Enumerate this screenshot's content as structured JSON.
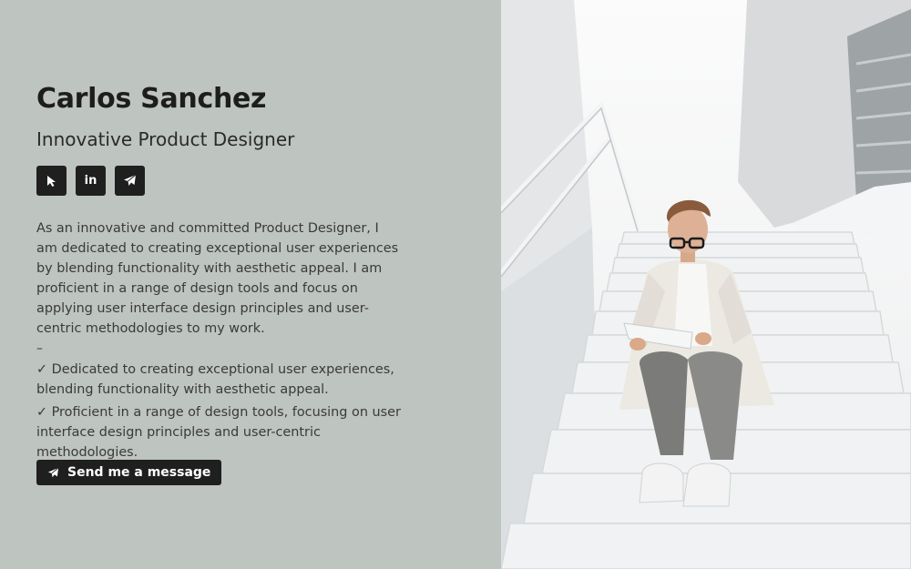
{
  "profile": {
    "name": "Carlos Sanchez",
    "role": "Innovative Product Designer",
    "bio": "As an innovative and committed Product Designer, I am dedicated to creating exceptional user experiences by blending functionality with aesthetic appeal. I am proficient in a range of design tools and focus on applying user interface design principles and user-centric methodologies to my work.",
    "separator": "–",
    "bullets": [
      "✓ Dedicated to creating exceptional user experiences, blending functionality with aesthetic appeal.",
      "✓ Proficient in a range of design tools, focusing on user interface design principles and user-centric methodologies."
    ]
  },
  "socials": [
    {
      "icon": "cursor-icon"
    },
    {
      "icon": "linkedin-icon",
      "label": "in"
    },
    {
      "icon": "send-icon"
    }
  ],
  "cta": {
    "label": "Send me a message",
    "icon": "send-icon"
  },
  "colors": {
    "panel": "#bec4bf",
    "button": "#1f1f1f",
    "text": "#222222"
  },
  "photo": {
    "icon": "person-on-stairs-photo"
  }
}
